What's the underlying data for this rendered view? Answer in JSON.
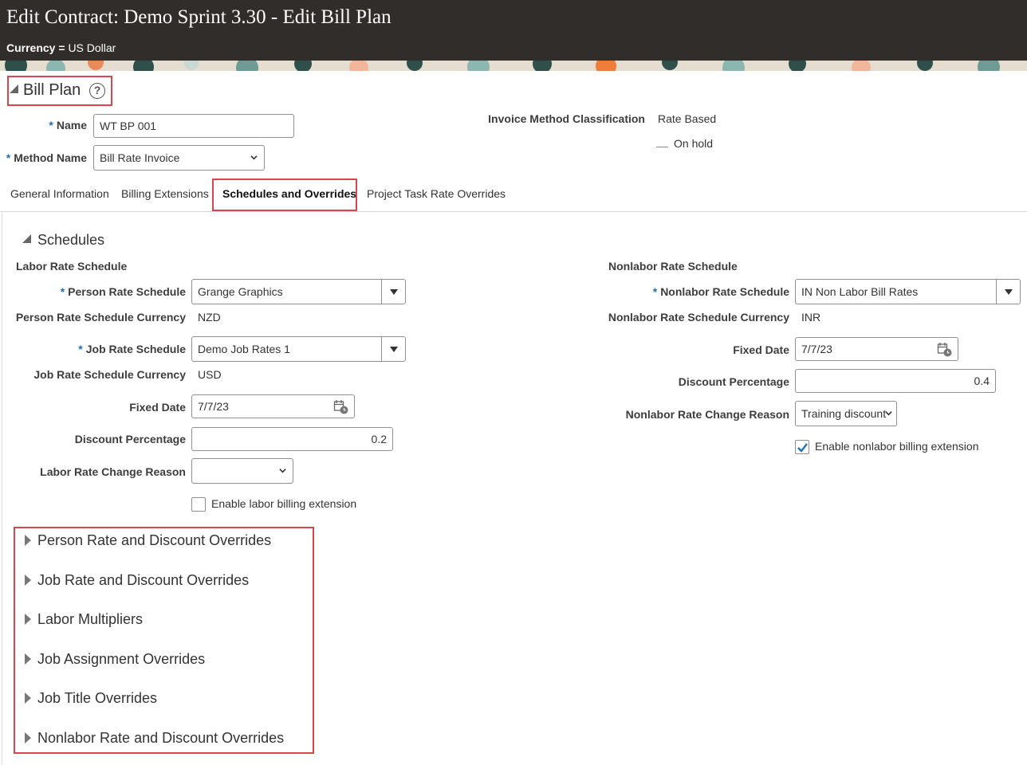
{
  "header": {
    "title": "Edit Contract: Demo Sprint 3.30 - Edit Bill Plan",
    "currency_label": "Currency =",
    "currency_value": "US Dollar"
  },
  "bill_plan": {
    "title": "Bill Plan",
    "help_glyph": "?",
    "name_label": "Name",
    "name_value": "WT BP 001",
    "method_label": "Method Name",
    "method_value": "Bill Rate Invoice",
    "invoice_method_label": "Invoice Method Classification",
    "invoice_method_value": "Rate Based",
    "on_hold_label": "On hold",
    "required_mark": "*"
  },
  "tabs": [
    {
      "label": "General Information",
      "active": false
    },
    {
      "label": "Billing Extensions",
      "active": false
    },
    {
      "label": "Schedules and Overrides",
      "active": true
    },
    {
      "label": "Project Task Rate Overrides",
      "active": false
    }
  ],
  "schedules": {
    "title": "Schedules",
    "labor": {
      "heading": "Labor Rate Schedule",
      "person_rate_label": "Person Rate Schedule",
      "person_rate_value": "Grange Graphics",
      "person_currency_label": "Person Rate Schedule Currency",
      "person_currency_value": "NZD",
      "job_rate_label": "Job Rate Schedule",
      "job_rate_value": "Demo Job Rates 1",
      "job_currency_label": "Job Rate Schedule Currency",
      "job_currency_value": "USD",
      "fixed_date_label": "Fixed Date",
      "fixed_date_value": "7/7/23",
      "discount_label": "Discount Percentage",
      "discount_value": "0.2",
      "change_reason_label": "Labor Rate Change Reason",
      "change_reason_value": "",
      "extension_label": "Enable labor billing extension",
      "extension_checked": false
    },
    "nonlabor": {
      "heading": "Nonlabor Rate Schedule",
      "rate_label": "Nonlabor Rate Schedule",
      "rate_value": "IN Non Labor Bill Rates",
      "currency_label": "Nonlabor Rate Schedule Currency",
      "currency_value": "INR",
      "fixed_date_label": "Fixed Date",
      "fixed_date_value": "7/7/23",
      "discount_label": "Discount Percentage",
      "discount_value": "0.4",
      "change_reason_label": "Nonlabor Rate Change Reason",
      "change_reason_value": "Training discount",
      "extension_label": "Enable nonlabor billing extension",
      "extension_checked": true
    }
  },
  "overrides": [
    "Person Rate and Discount Overrides",
    "Job Rate and Discount Overrides",
    "Labor Multipliers",
    "Job Assignment Overrides",
    "Job Title Overrides",
    "Nonlabor Rate and Discount Overrides"
  ],
  "colors": {
    "header_bg": "#312d2a",
    "highlight_red": "#d9454f",
    "required_blue": "#1f6fb5",
    "checkbox_blue": "#1f6fb5"
  }
}
